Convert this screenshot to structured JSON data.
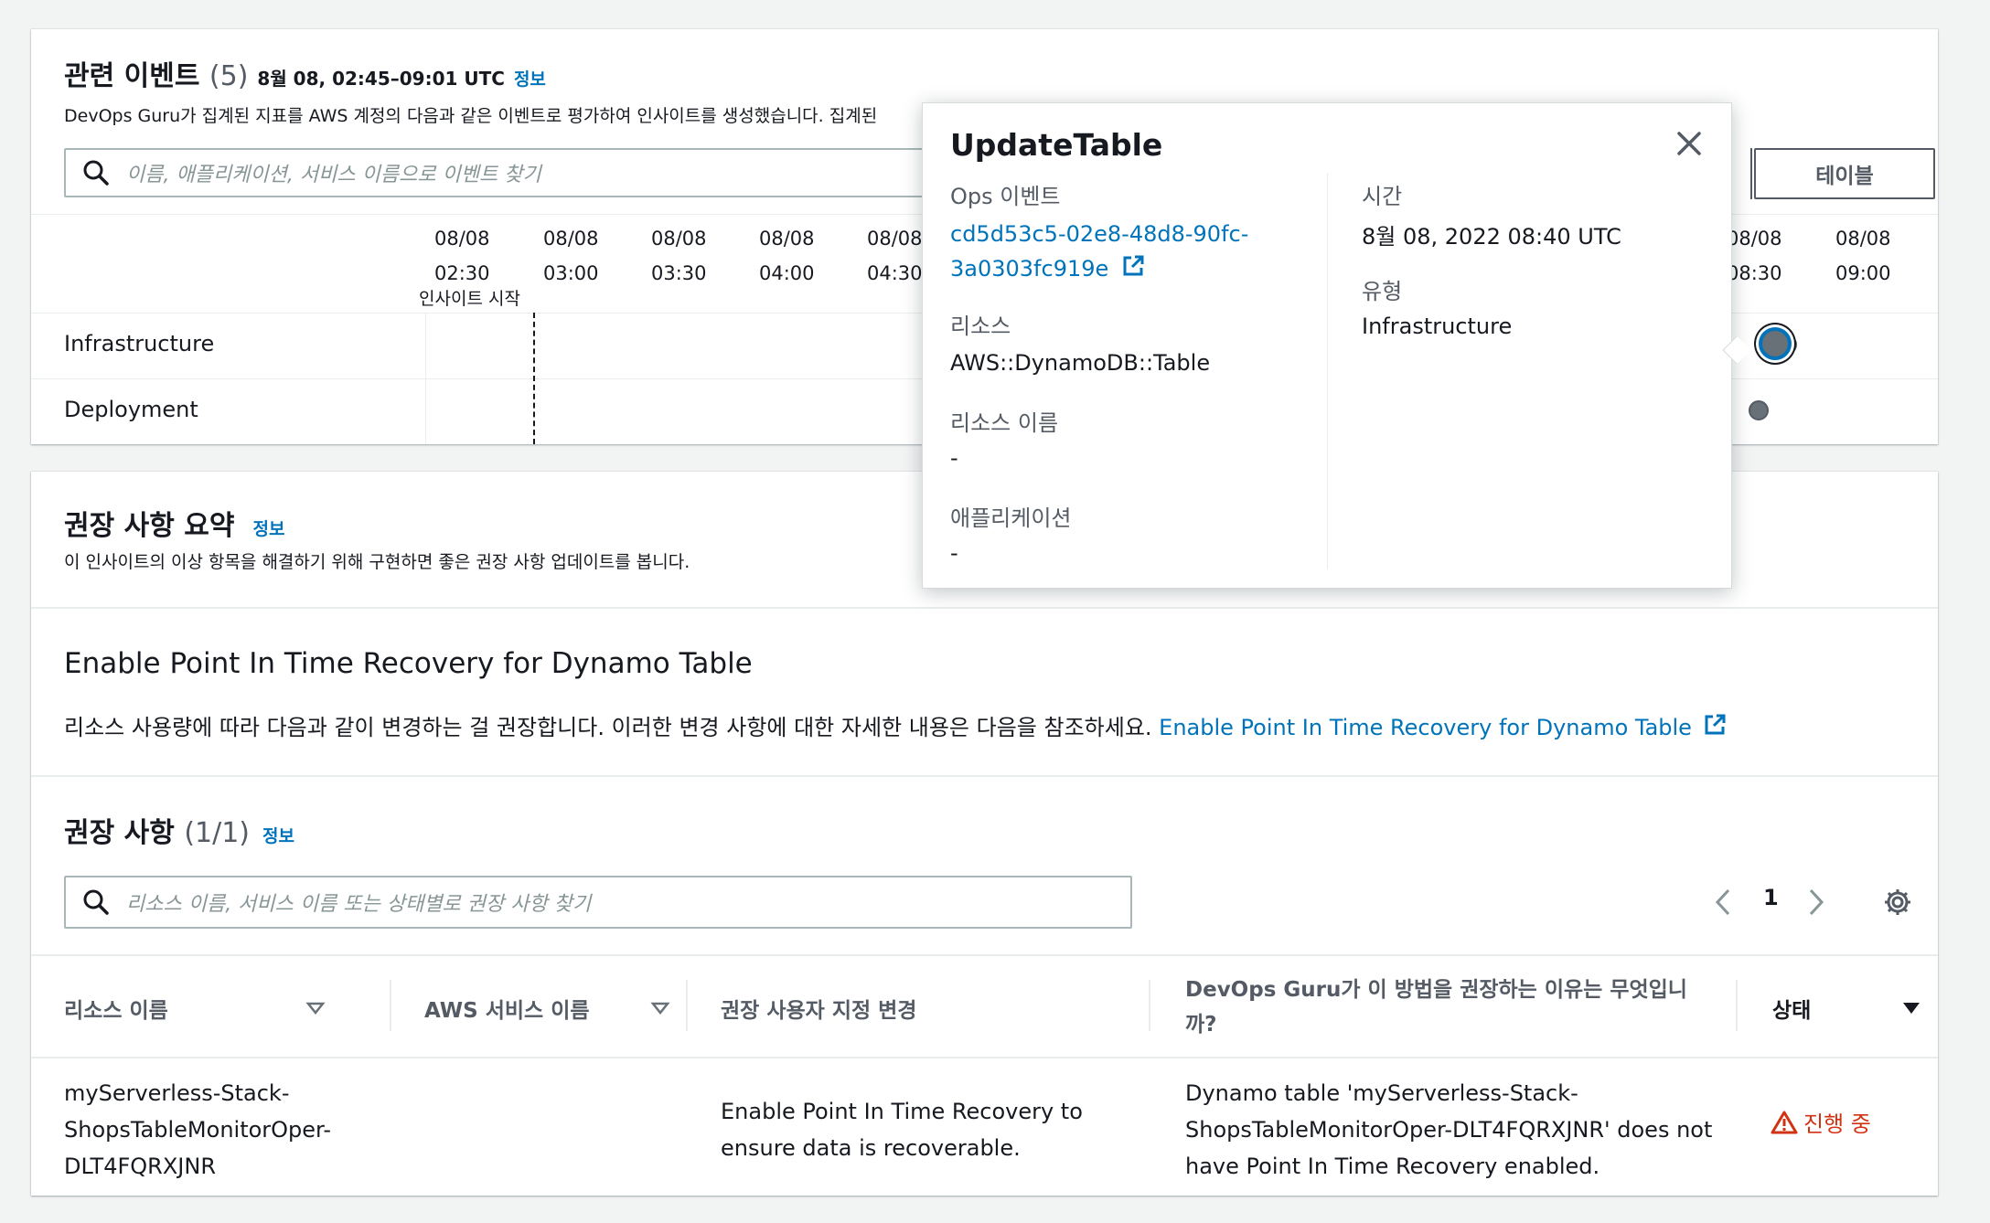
{
  "events": {
    "title": "관련 이벤트",
    "count": "(5)",
    "range": "8월 08, 02:45–09:01 UTC",
    "info": "정보",
    "description": "DevOps Guru가 집계된 지표를 AWS 계정의 다음과 같은 이벤트로 평가하여 인사이트를 생성했습니다. 집계된",
    "search_placeholder": "이름, 애플리케이션, 서비스 이름으로 이벤트 찾기",
    "table_button": "테이블",
    "insight_start": "인사이트 시작",
    "ticks": [
      {
        "date": "08/08",
        "time": "02:30"
      },
      {
        "date": "08/08",
        "time": "03:00"
      },
      {
        "date": "08/08",
        "time": "03:30"
      },
      {
        "date": "08/08",
        "time": "04:00"
      },
      {
        "date": "08/08",
        "time": "04:30"
      },
      {
        "date": "08/08",
        "time": "08:30"
      },
      {
        "date": "08/08",
        "time": "09:00"
      }
    ],
    "rows": [
      "Infrastructure",
      "Deployment"
    ]
  },
  "popover": {
    "title": "UpdateTable",
    "ops_label": "Ops 이벤트",
    "ops_value_line1": "cd5d53c5-02e8-48d8-90fc-",
    "ops_value_line2": "3a0303fc919e",
    "resource_label": "리소스",
    "resource_value": "AWS::DynamoDB::Table",
    "resource_name_label": "리소스 이름",
    "resource_name_value": "-",
    "application_label": "애플리케이션",
    "application_value": "-",
    "time_label": "시간",
    "time_value": "8월 08, 2022 08:40 UTC",
    "type_label": "유형",
    "type_value": "Infrastructure"
  },
  "summary": {
    "title": "권장 사항 요약",
    "info": "정보",
    "description": "이 인사이트의 이상 항목을 해결하기 위해 구현하면 좋은 권장 사항 업데이트를 봅니다.",
    "card_title": "Enable Point In Time Recovery for Dynamo Table",
    "card_text": "리소스 사용량에 따라 다음과 같이 변경하는 걸 권장합니다. 이러한 변경 사항에 대한 자세한 내용은 다음을 참조하세요.",
    "card_link": "Enable Point In Time Recovery for Dynamo Table"
  },
  "recommendations": {
    "title": "권장 사항",
    "count": "(1/1)",
    "info": "정보",
    "search_placeholder": "리소스 이름, 서비스 이름 또는 상태별로 권장 사항 찾기",
    "page": "1",
    "columns": {
      "resource": "리소스 이름",
      "service": "AWS 서비스 이름",
      "change": "권장 사용자 지정 변경",
      "why_line1": "DevOps Guru가 이 방법을 권장하는 이유는 무엇입니",
      "why_line2": "까?",
      "status": "상태"
    },
    "row": {
      "resource_1": "myServerless-Stack-",
      "resource_2": "ShopsTableMonitorOper-",
      "resource_3": "DLT4FQRXJNR",
      "change_1": "Enable Point In Time Recovery to",
      "change_2": "ensure data is recoverable.",
      "why_1": "Dynamo table 'myServerless-Stack-",
      "why_2": "ShopsTableMonitorOper-DLT4FQRXJNR' does not",
      "why_3": "have Point In Time Recovery enabled.",
      "status": "진행 중"
    }
  },
  "colors": {
    "link": "#0073bb",
    "status_in_progress": "#d13212",
    "text": "#16191f"
  }
}
